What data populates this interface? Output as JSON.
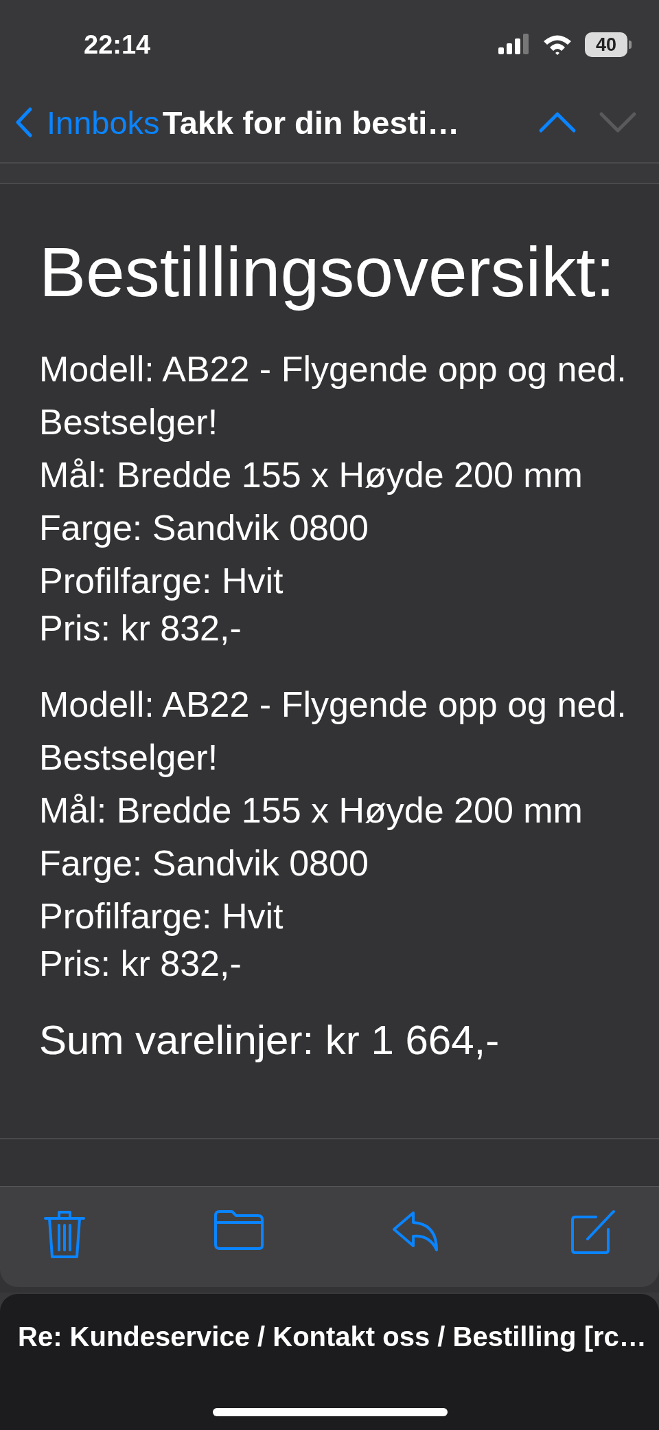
{
  "status_bar": {
    "time": "22:14",
    "battery": "40"
  },
  "nav": {
    "back": "Innboks",
    "title": "Takk for din besti…",
    "previous_disabled": false,
    "next_disabled": true
  },
  "email": {
    "heading": "Bestillingsoversikt:",
    "items": [
      {
        "model": "Modell: AB22 - Flygende opp og ned.",
        "note": "Bestselger!",
        "size": "Mål: Bredde 155 x Høyde 200 mm",
        "shade": "Farge: Sandvik 0800",
        "profile_color": "Profilfarge: Hvit",
        "price": "Pris: kr 832,-"
      },
      {
        "model": "Modell: AB22 - Flygende opp og ned.",
        "note": "Bestselger!",
        "size": "Mål: Bredde 155 x Høyde 200 mm",
        "shade": "Farge: Sandvik 0800",
        "profile_color": "Profilfarge: Hvit",
        "price": "Pris: kr 832,-"
      }
    ],
    "total": "Sum varelinjer: kr 1 664,-"
  },
  "draft": {
    "subject": "Re: Kundeservice / Kontakt oss / Bestilling [rc…"
  }
}
